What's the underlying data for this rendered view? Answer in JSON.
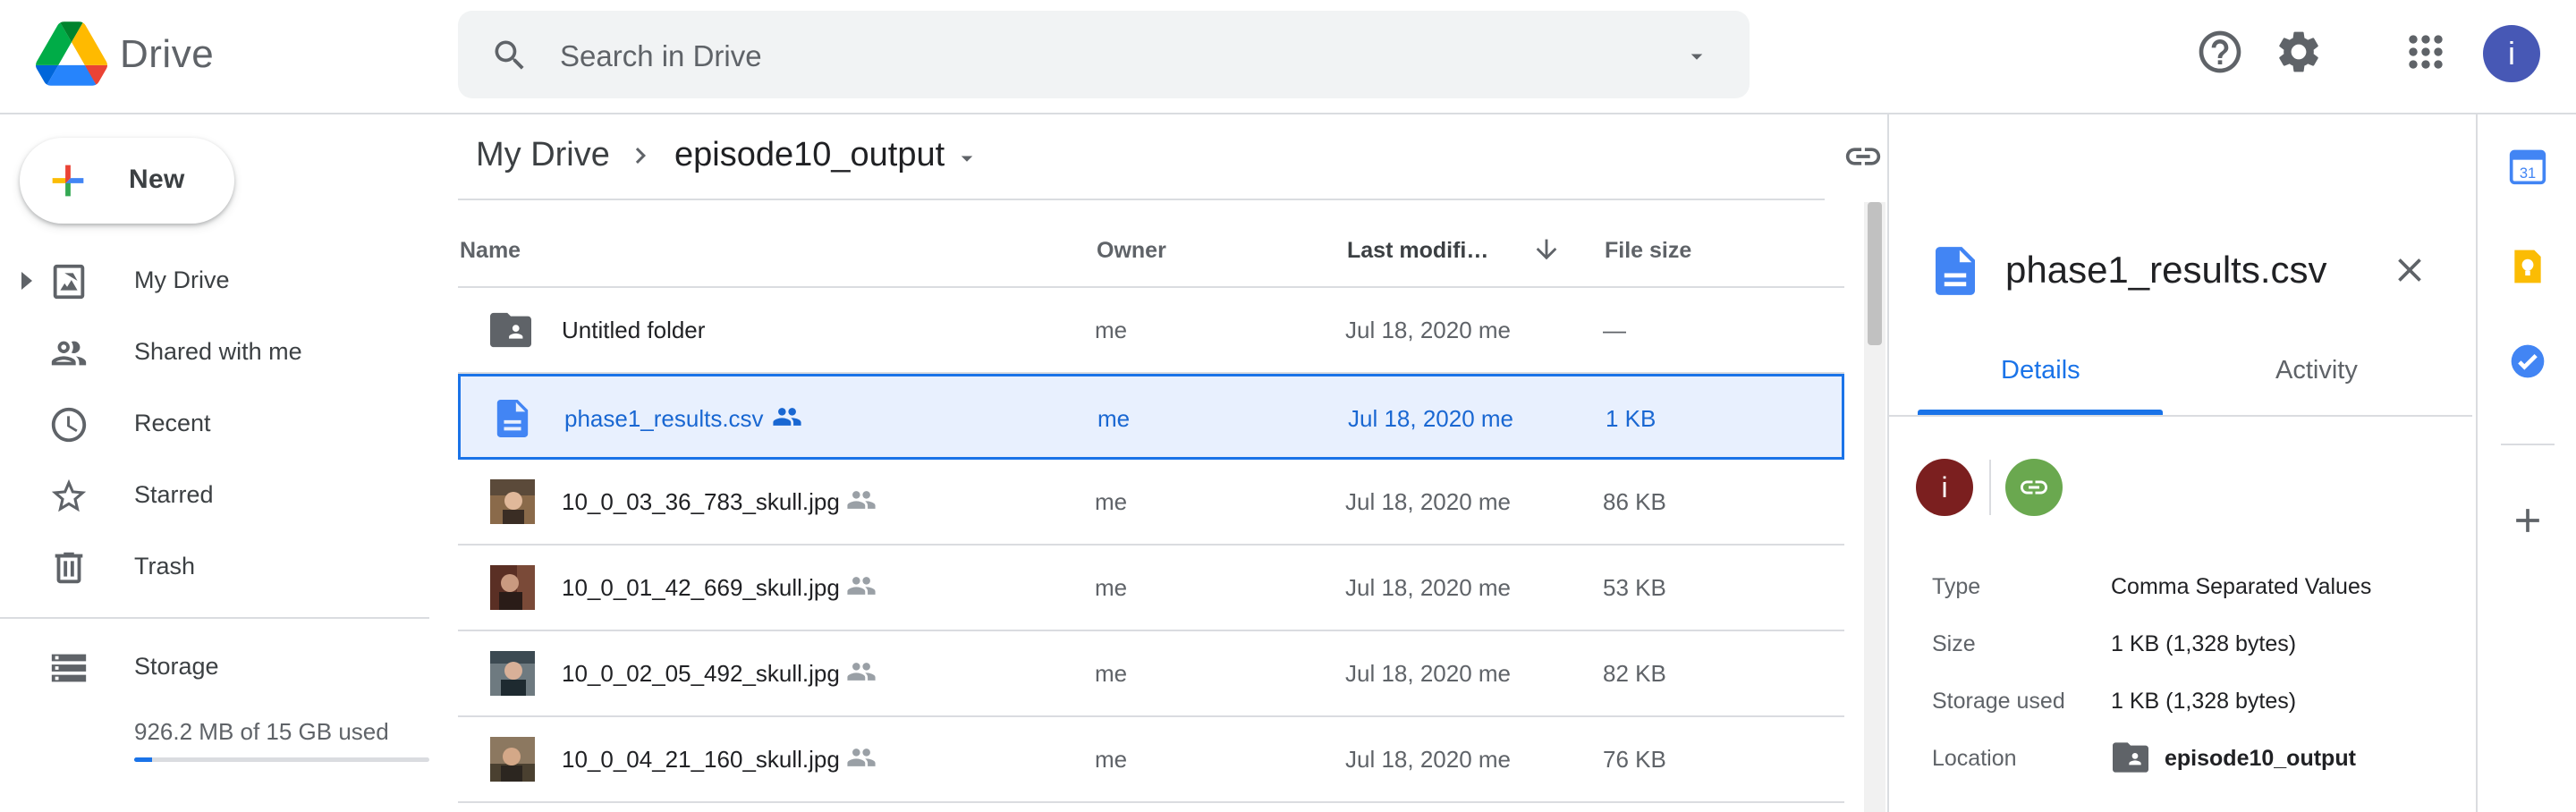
{
  "app": {
    "brand": "Drive"
  },
  "search": {
    "placeholder": "Search in Drive"
  },
  "account": {
    "avatar_letter": "i"
  },
  "new_button": {
    "label": "New"
  },
  "nav": {
    "items": [
      {
        "label": "My Drive",
        "icon": "drive-icon"
      },
      {
        "label": "Shared with me",
        "icon": "people-icon"
      },
      {
        "label": "Recent",
        "icon": "clock-icon"
      },
      {
        "label": "Starred",
        "icon": "star-icon"
      },
      {
        "label": "Trash",
        "icon": "trash-icon"
      }
    ],
    "storage": {
      "label": "Storage",
      "used_text": "926.2 MB of 15 GB used",
      "fraction": 0.062
    }
  },
  "breadcrumb": {
    "root": "My Drive",
    "current": "episode10_output"
  },
  "list": {
    "columns": {
      "name": "Name",
      "owner": "Owner",
      "modified": "Last modifi…",
      "size": "File size"
    },
    "rows": [
      {
        "name": "Untitled folder",
        "owner": "me",
        "modified": "Jul 18, 2020  me",
        "size": "—",
        "kind": "folder",
        "shared": false,
        "selected": false
      },
      {
        "name": "phase1_results.csv",
        "owner": "me",
        "modified": "Jul 18, 2020  me",
        "size": "1 KB",
        "kind": "doc",
        "shared": true,
        "selected": true
      },
      {
        "name": "10_0_03_36_783_skull.jpg",
        "owner": "me",
        "modified": "Jul 18, 2020  me",
        "size": "86 KB",
        "kind": "image",
        "shared": true,
        "selected": false
      },
      {
        "name": "10_0_01_42_669_skull.jpg",
        "owner": "me",
        "modified": "Jul 18, 2020  me",
        "size": "53 KB",
        "kind": "image",
        "shared": true,
        "selected": false
      },
      {
        "name": "10_0_02_05_492_skull.jpg",
        "owner": "me",
        "modified": "Jul 18, 2020  me",
        "size": "82 KB",
        "kind": "image",
        "shared": true,
        "selected": false
      },
      {
        "name": "10_0_04_21_160_skull.jpg",
        "owner": "me",
        "modified": "Jul 18, 2020  me",
        "size": "76 KB",
        "kind": "image",
        "shared": true,
        "selected": false
      }
    ]
  },
  "details": {
    "title": "phase1_results.csv",
    "tabs": {
      "details": "Details",
      "activity": "Activity"
    },
    "owner_letter": "i",
    "props": [
      {
        "label": "Type",
        "value": "Comma Separated Values"
      },
      {
        "label": "Size",
        "value": "1 KB (1,328 bytes)"
      },
      {
        "label": "Storage used",
        "value": "1 KB (1,328 bytes)"
      },
      {
        "label": "Location",
        "value": "episode10_output"
      }
    ]
  },
  "side_panel": {
    "calendar_day": "31"
  },
  "colors": {
    "accent": "#1a73e8",
    "selected_bg": "#e8f0fe",
    "avatar": "#4758b5"
  }
}
